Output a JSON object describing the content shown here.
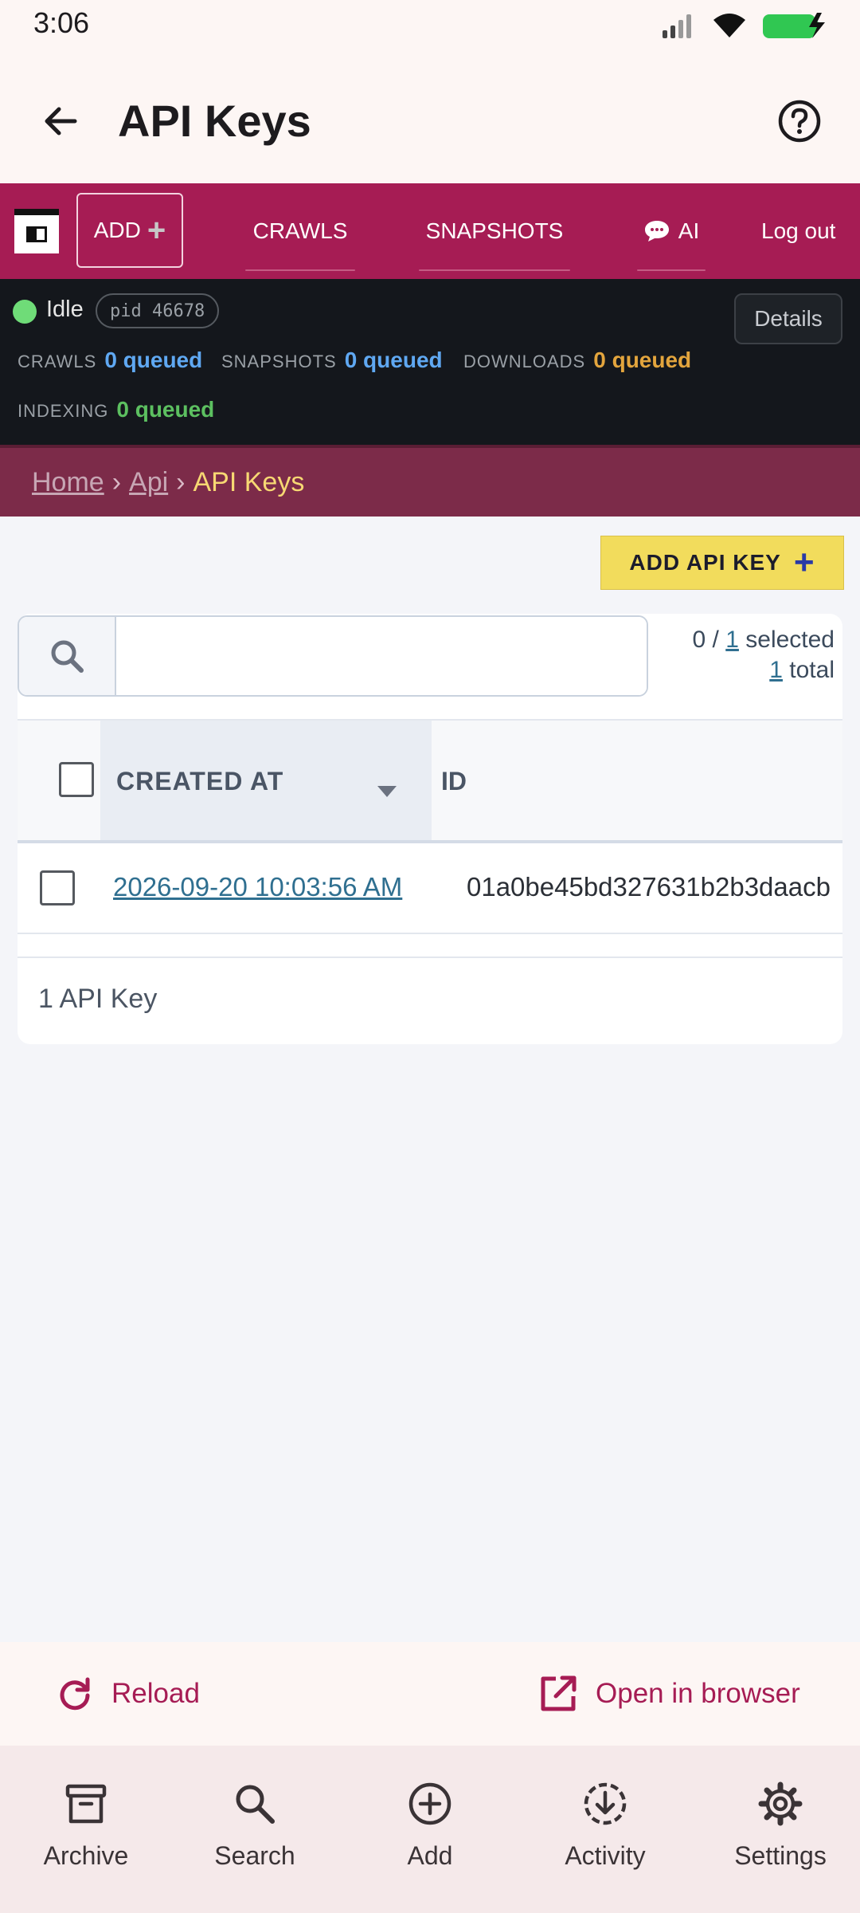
{
  "status_bar": {
    "time": "3:06"
  },
  "app_bar": {
    "title": "API Keys"
  },
  "nav": {
    "add_label": "ADD",
    "links": [
      "CRAWLS",
      "SNAPSHOTS",
      "AI",
      "Log out"
    ]
  },
  "status_panel": {
    "state": "Idle",
    "pid": "pid 46678",
    "details_label": "Details",
    "queues": [
      {
        "label": "CRAWLS",
        "value": "0 queued",
        "color": "#5fa8f2"
      },
      {
        "label": "SNAPSHOTS",
        "value": "0 queued",
        "color": "#5fa8f2"
      },
      {
        "label": "DOWNLOADS",
        "value": "0 queued",
        "color": "#e3a53d"
      },
      {
        "label": "INDEXING",
        "value": "0 queued",
        "color": "#5cc060"
      }
    ]
  },
  "breadcrumb": {
    "home": "Home",
    "sep": "›",
    "api": "Api",
    "current": "API Keys"
  },
  "toolbar": {
    "add_api_key_label": "ADD API KEY"
  },
  "search": {
    "value": "",
    "placeholder": ""
  },
  "selection": {
    "selected_prefix": "0 / ",
    "selected_count": "1",
    "selected_suffix": " selected",
    "total_count": "1",
    "total_suffix": " total"
  },
  "table": {
    "columns": [
      "CREATED AT",
      "ID"
    ],
    "rows": [
      {
        "created_at": "2026-09-20 10:03:56 AM",
        "id": "01a0be45bd327631b2b3daacb"
      }
    ],
    "footer": "1 API Key"
  },
  "actions": {
    "reload": "Reload",
    "open_in_browser": "Open in browser"
  },
  "bottom_nav": {
    "items": [
      {
        "label": "Archive",
        "icon": "archive-icon"
      },
      {
        "label": "Search",
        "icon": "search-icon"
      },
      {
        "label": "Add",
        "icon": "add-circle-icon"
      },
      {
        "label": "Activity",
        "icon": "download-circle-icon"
      },
      {
        "label": "Settings",
        "icon": "gear-icon"
      }
    ]
  },
  "colors": {
    "brand": "#a61c54",
    "accent_yellow": "#f2dc5c",
    "link": "#2f6f90"
  }
}
